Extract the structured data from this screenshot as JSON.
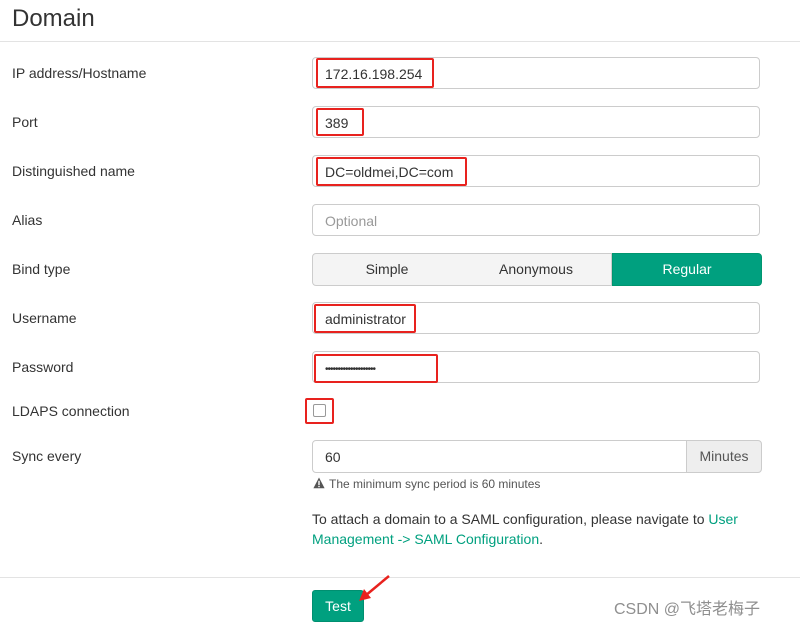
{
  "page": {
    "title": "Domain"
  },
  "form": {
    "ip_label": "IP address/Hostname",
    "ip_value": "172.16.198.254",
    "port_label": "Port",
    "port_value": "389",
    "dn_label": "Distinguished name",
    "dn_value": "DC=oldmei,DC=com",
    "alias_label": "Alias",
    "alias_placeholder": "Optional",
    "bind_label": "Bind type",
    "bind_options": [
      "Simple",
      "Anonymous",
      "Regular"
    ],
    "bind_selected": "Regular",
    "username_label": "Username",
    "username_value": "administrator",
    "password_label": "Password",
    "password_value": "••••••••••••••••••••",
    "ldaps_label": "LDAPS connection",
    "ldaps_checked": false,
    "sync_label": "Sync every",
    "sync_value": "60",
    "sync_unit": "Minutes",
    "sync_hint": "The minimum sync period is 60 minutes",
    "saml_text_before": "To attach a domain to a SAML configuration, please navigate to ",
    "saml_link": "User Management -> SAML Configuration",
    "saml_text_after": "."
  },
  "actions": {
    "test_label": "Test"
  },
  "watermark": "CSDN @飞塔老梅子",
  "colors": {
    "accent": "#00a07f",
    "highlight": "#e8221e"
  },
  "icons": {
    "warning": "warning-icon",
    "arrow": "red-arrow-annotation"
  }
}
